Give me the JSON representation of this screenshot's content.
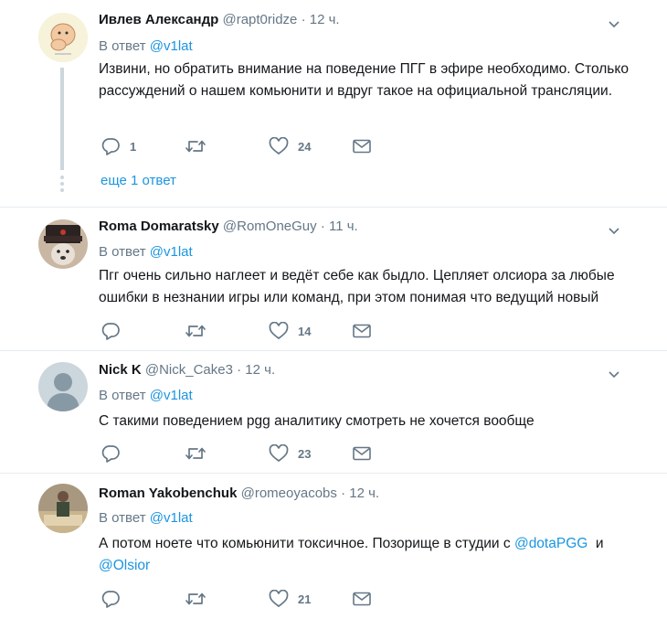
{
  "tweets": [
    {
      "name": "Ивлев Александр",
      "handle": "@rapt0ridze",
      "dot": "·",
      "time": "12 ч.",
      "reply_prefix": "В ответ",
      "reply_to": "@v1lat",
      "text": "Извини, но обратить внимание на поведение ПГГ в эфире необходимо. Столько рассуждений о нашем комьюнити и вдруг такое на официальной трансляции.",
      "replies": "1",
      "retweets": "",
      "likes": "24",
      "more_replies": "еще 1 ответ"
    },
    {
      "name": "Roma Domaratsky",
      "handle": "@RomOneGuy",
      "dot": "·",
      "time": "11 ч.",
      "reply_prefix": "В ответ",
      "reply_to": "@v1lat",
      "text": "Пгг очень сильно наглеет и ведёт себе как быдло. Цепляет олсиора за любые ошибки в незнании игры или команд, при этом понимая что ведущий новый",
      "replies": "",
      "retweets": "",
      "likes": "14"
    },
    {
      "name": "Nick K",
      "handle": "@Nick_Cake3",
      "dot": "·",
      "time": "12 ч.",
      "reply_prefix": "В ответ",
      "reply_to": "@v1lat",
      "text": "С такими поведением pgg аналитику смотреть не хочется вообще",
      "replies": "",
      "retweets": "",
      "likes": "23"
    },
    {
      "name": "Roman Yakobenchuk",
      "handle": "@romeoyacobs",
      "dot": "·",
      "time": "12 ч.",
      "reply_prefix": "В ответ",
      "reply_to": "@v1lat",
      "text_before": "А потом ноете что комьюнити токсичное. Позорище в студии с ",
      "mention1": "@dotaPGG",
      "text_mid": "  и",
      "mention2": "@Olsior",
      "replies": "",
      "retweets": "",
      "likes": "21"
    }
  ],
  "colors": {
    "link": "#1b95e0",
    "muted": "#657786",
    "text": "#14171a",
    "separator": "#e6ecf0"
  },
  "icons": [
    "reply-icon",
    "retweet-icon",
    "like-icon",
    "dm-icon",
    "chevron-down-icon"
  ]
}
